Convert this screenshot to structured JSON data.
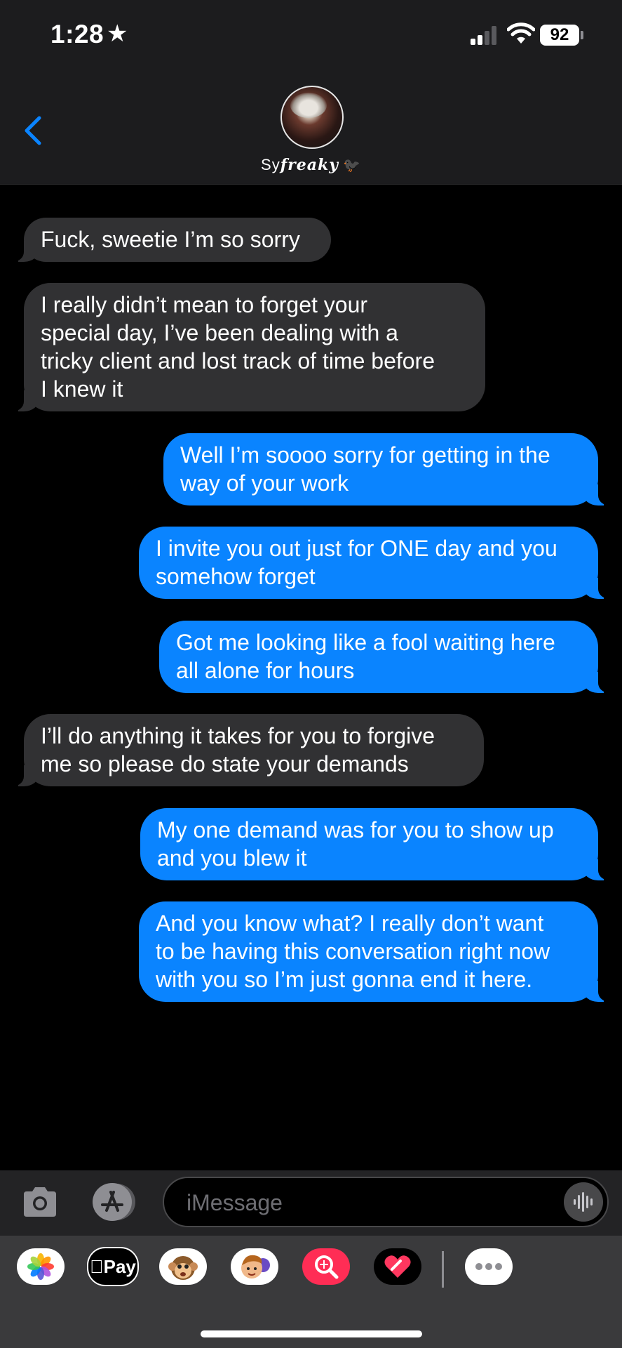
{
  "status_bar": {
    "time": "1:28",
    "battery": "92"
  },
  "header": {
    "contact_name_plain": "Sy",
    "contact_name_fancy": "freaky",
    "contact_emoji": "🐦‍⬛"
  },
  "messages": [
    {
      "side": "in",
      "text": "Fuck, sweetie I’m so sorry"
    },
    {
      "side": "in",
      "text": "I really didn’t mean to forget your\nspecial day, I’ve been dealing with a\ntricky client and lost track of time before\nI knew it"
    },
    {
      "side": "out",
      "text": "Well I’m soooo sorry for getting in the\nway of your work"
    },
    {
      "side": "out",
      "text": "I invite you out just for ONE day and you\nsomehow forget"
    },
    {
      "side": "out",
      "text": "Got me looking like a fool waiting here\nall alone for hours"
    },
    {
      "side": "in",
      "text": "I’ll do anything it takes for you to forgive\nme so please do state your demands"
    },
    {
      "side": "out",
      "text": "My one demand was for you to show up\nand you blew it"
    },
    {
      "side": "out",
      "text": "And you know what? I really don’t want\nto be having this conversation right now\nwith you so I’m just gonna end it here."
    }
  ],
  "input": {
    "placeholder": "iMessage"
  },
  "apps": {
    "applepay_label": "Pay"
  },
  "colors": {
    "outgoing": "#0a84ff",
    "incoming": "#313133",
    "header_bg": "#1c1c1e",
    "accent": "#0a84ff"
  }
}
